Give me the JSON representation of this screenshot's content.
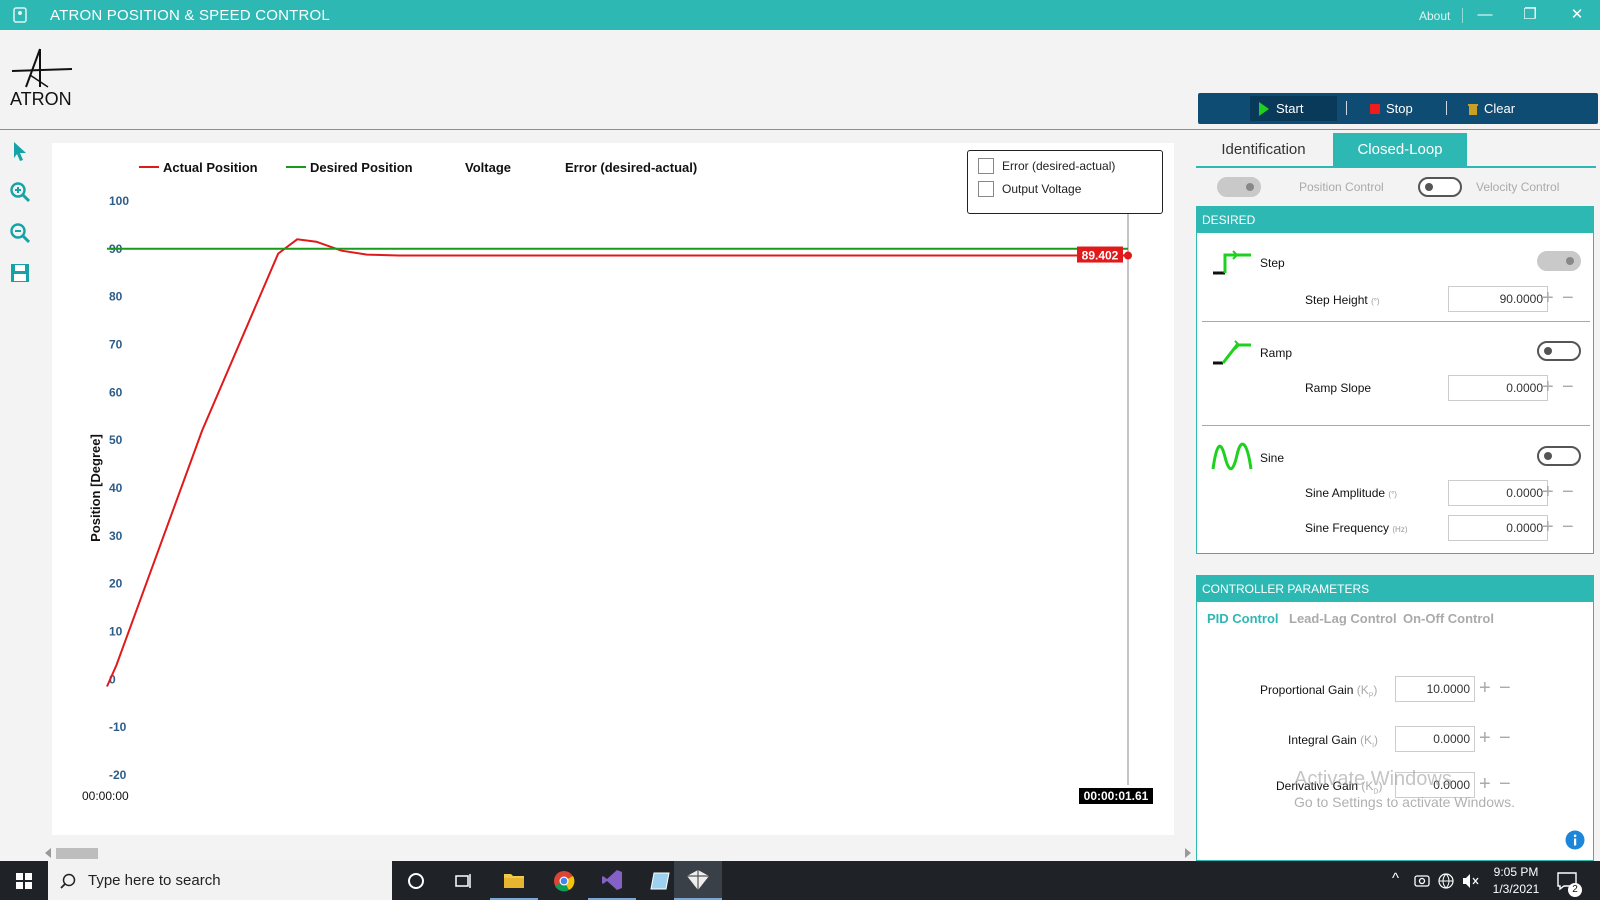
{
  "window": {
    "title": "ATRON POSITION & SPEED CONTROL",
    "about": "About",
    "min": "—",
    "max": "❐",
    "close": "✕"
  },
  "logo": {
    "text": "ATRON"
  },
  "controls": {
    "start": "Start",
    "stop": "Stop",
    "clear": "Clear"
  },
  "toolbar": [
    "pointer-icon",
    "zoom-in-icon",
    "zoom-out-icon",
    "save-icon"
  ],
  "chart_data": {
    "type": "line",
    "legend": [
      "Actual Position",
      "Desired Position",
      "Voltage",
      "Error (desired-actual)"
    ],
    "colors": {
      "actual": "#e0191b",
      "desired": "#1a9a1a"
    },
    "ylabel": "Position [Degree]",
    "ylim": [
      -20,
      100
    ],
    "yticks": [
      "100",
      "90",
      "80",
      "70",
      "60",
      "50",
      "40",
      "30",
      "20",
      "10",
      "0",
      "-10",
      "-20"
    ],
    "x_start_label": "00:00:00",
    "x_end_label": "00:00:01.61",
    "xlim": [
      0,
      1.61
    ],
    "series": [
      {
        "name": "Actual Position",
        "points": [
          [
            0.0,
            -1.5
          ],
          [
            0.015,
            3
          ],
          [
            0.15,
            52
          ],
          [
            0.27,
            89
          ],
          [
            0.3,
            92
          ],
          [
            0.33,
            91.5
          ],
          [
            0.37,
            89.6
          ],
          [
            0.41,
            88.8
          ],
          [
            0.46,
            88.6
          ],
          [
            0.7,
            88.6
          ],
          [
            1.61,
            88.6
          ]
        ]
      },
      {
        "name": "Desired Position",
        "points": [
          [
            0.0,
            90
          ],
          [
            1.61,
            90
          ]
        ]
      }
    ],
    "cursor_value": "89.402",
    "options": [
      "Error (desired-actual)",
      "Output Voltage"
    ]
  },
  "tabs": {
    "identification": "Identification",
    "closed_loop": "Closed-Loop"
  },
  "modes": {
    "position": "Position Control",
    "velocity": "Velocity Control"
  },
  "desired": {
    "header": "DESIRED",
    "step": {
      "name": "Step",
      "param": "Step Height",
      "unit": "(°)",
      "value": "90.0000"
    },
    "ramp": {
      "name": "Ramp",
      "param": "Ramp Slope",
      "value": "0.0000"
    },
    "sine": {
      "name": "Sine",
      "amp": "Sine Amplitude",
      "amp_unit": "(°)",
      "amp_value": "0.0000",
      "freq": "Sine Frequency",
      "freq_unit": "(Hz)",
      "freq_value": "0.0000"
    }
  },
  "controller": {
    "header": "CONTROLLER PARAMETERS",
    "tabs": [
      "PID Control",
      "Lead-Lag Control",
      "On-Off Control"
    ],
    "kp": {
      "label": "Proportional Gain",
      "sym": "(K",
      "sub": "P",
      "close": ")",
      "value": "10.0000"
    },
    "ki": {
      "label": "Integral Gain",
      "sym": "(K",
      "sub": "I",
      "close": ")",
      "value": "0.0000"
    },
    "kd": {
      "label": "Derivative Gain",
      "sym": "(K",
      "sub": "D",
      "close": ")",
      "value": "0.0000"
    }
  },
  "watermark": {
    "line1": "Activate Windows",
    "line2": "Go to Settings to activate Windows."
  },
  "taskbar": {
    "search": "Type here to search",
    "time": "9:05 PM",
    "date": "1/3/2021",
    "badge": "2"
  }
}
